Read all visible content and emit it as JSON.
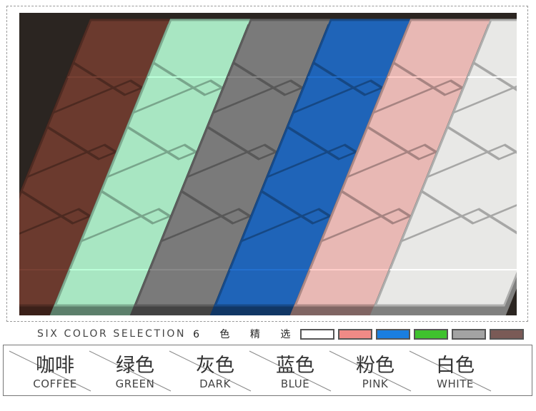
{
  "selection": {
    "label": "SIX COLOR SELECTION",
    "count": "6 色 精 选",
    "swatches": [
      {
        "name": "white",
        "color": "#ffffff"
      },
      {
        "name": "pink",
        "color": "#f08a86"
      },
      {
        "name": "blue",
        "color": "#1a7ee0"
      },
      {
        "name": "green",
        "color": "#3fc22e"
      },
      {
        "name": "gray",
        "color": "#a3a3a3"
      },
      {
        "name": "coffee",
        "color": "#7a5a56"
      }
    ]
  },
  "colors": [
    {
      "cn": "咖啡",
      "en": "COFFEE"
    },
    {
      "cn": "绿色",
      "en": "GREEN"
    },
    {
      "cn": "灰色",
      "en": "DARK"
    },
    {
      "cn": "蓝色",
      "en": "BLUE"
    },
    {
      "cn": "粉色",
      "en": "PINK"
    },
    {
      "cn": "白色",
      "en": "WHITE"
    }
  ],
  "panel_colors": [
    "#6b3a2e",
    "#a8e6c2",
    "#7a7a7a",
    "#1f64b8",
    "#e8b8b4",
    "#e8e8e6"
  ]
}
